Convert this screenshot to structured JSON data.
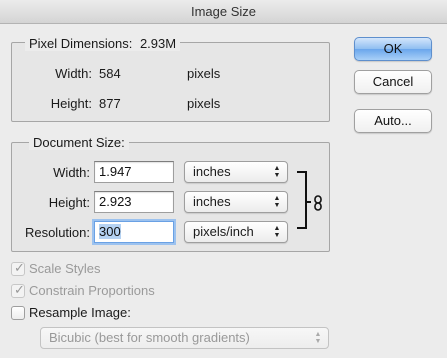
{
  "window": {
    "title": "Image Size"
  },
  "pixel_dimensions": {
    "label": "Pixel Dimensions:",
    "size": "2.93M",
    "width_label": "Width:",
    "width_value": "584",
    "width_unit": "pixels",
    "height_label": "Height:",
    "height_value": "877",
    "height_unit": "pixels"
  },
  "document_size": {
    "label": "Document Size:",
    "width_label": "Width:",
    "width_value": "1.947",
    "width_unit": "inches",
    "height_label": "Height:",
    "height_value": "2.923",
    "height_unit": "inches",
    "resolution_label": "Resolution:",
    "resolution_value": "300",
    "resolution_unit": "pixels/inch",
    "constrain_link_icon": "chain-link-icon"
  },
  "buttons": {
    "ok": "OK",
    "cancel": "Cancel",
    "auto": "Auto..."
  },
  "options": {
    "scale_styles": {
      "label": "Scale Styles",
      "checked": true,
      "enabled": false
    },
    "constrain_proportions": {
      "label": "Constrain Proportions",
      "checked": true,
      "enabled": false
    },
    "resample_image": {
      "label": "Resample Image:",
      "checked": false,
      "enabled": true
    },
    "resample_method": "Bicubic (best for smooth gradients)"
  },
  "colors": {
    "default_button": "#6aa6ec",
    "focus_ring": "#9cc2ef",
    "window_bg": "#ececec"
  }
}
